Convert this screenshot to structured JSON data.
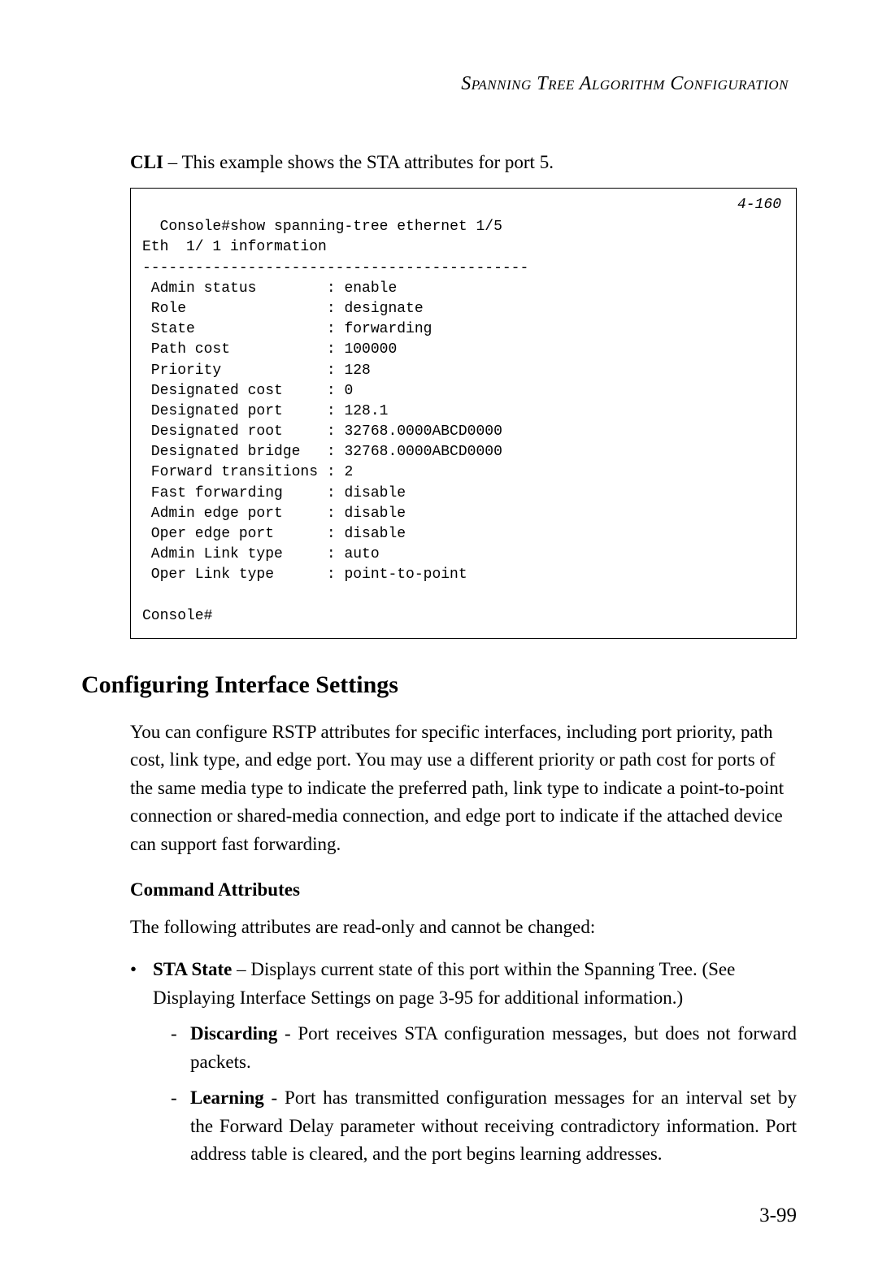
{
  "header": {
    "title": "Spanning Tree Algorithm Configuration"
  },
  "cli": {
    "intro_bold": "CLI",
    "intro_text": " – This example shows the STA attributes for port 5.",
    "ref": "4-160",
    "line_cmd": "Console#show spanning-tree ethernet 1/5",
    "line_eth": "Eth  1/ 1 information",
    "divider": "--------------------------------------------",
    "rows": [
      {
        "label": " Admin status",
        "value": "enable"
      },
      {
        "label": " Role",
        "value": "designate"
      },
      {
        "label": " State",
        "value": "forwarding"
      },
      {
        "label": " Path cost",
        "value": "100000"
      },
      {
        "label": " Priority",
        "value": "128"
      },
      {
        "label": " Designated cost",
        "value": "0"
      },
      {
        "label": " Designated port",
        "value": "128.1"
      },
      {
        "label": " Designated root",
        "value": "32768.0000ABCD0000"
      },
      {
        "label": " Designated bridge",
        "value": "32768.0000ABCD0000"
      },
      {
        "label": " Forward transitions",
        "value": "2"
      },
      {
        "label": " Fast forwarding",
        "value": "disable"
      },
      {
        "label": " Admin edge port",
        "value": "disable"
      },
      {
        "label": " Oper edge port",
        "value": "disable"
      },
      {
        "label": " Admin Link type",
        "value": "auto"
      },
      {
        "label": " Oper Link type",
        "value": "point-to-point"
      }
    ],
    "prompt_end": "Console#"
  },
  "section": {
    "heading": "Configuring Interface Settings",
    "para": "You can configure RSTP attributes for specific interfaces, including port priority, path cost, link type, and edge port. You may use a different priority or path cost for ports of the same media type to indicate the preferred path, link type to indicate a point-to-point connection or shared-media connection, and edge port to indicate if the attached device can support fast forwarding."
  },
  "attributes": {
    "subheading": "Command Attributes",
    "intro": "The following attributes are read-only and cannot be changed:",
    "bullet_label": "STA State",
    "bullet_text": " – Displays current state of this port within the Spanning Tree. (See Displaying Interface Settings on page 3-95 for additional information.)",
    "sub": [
      {
        "label": "Discarding",
        "text": " - Port receives STA configuration messages, but does not forward packets."
      },
      {
        "label": "Learning",
        "text": " - Port has transmitted configuration messages for an interval set by the Forward Delay parameter without receiving contradictory information. Port address table is cleared, and the port begins learning addresses."
      }
    ]
  },
  "page_number": "3-99"
}
